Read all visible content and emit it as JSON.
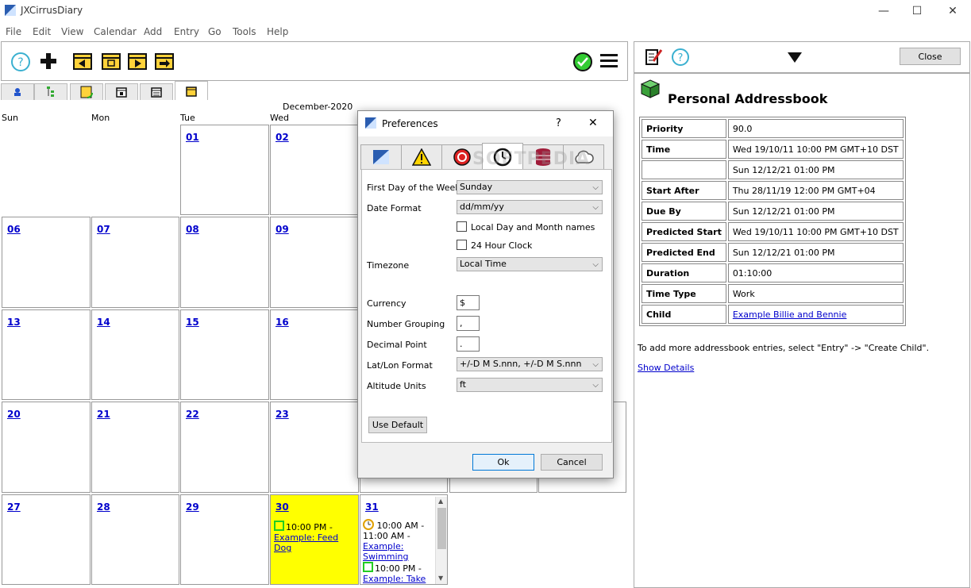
{
  "window": {
    "title": "JXCirrusDiary",
    "minimize": "—",
    "maximize": "☐",
    "close": "✕"
  },
  "menu": [
    "File",
    "Edit",
    "View",
    "Calendar",
    "Add",
    "Entry",
    "Go",
    "Tools",
    "Help"
  ],
  "calendar": {
    "month_title": "December-2020",
    "day_headers": [
      "Sun",
      "Mon",
      "Tue",
      "Wed"
    ],
    "weeks": [
      [
        "",
        "",
        "01",
        "02"
      ],
      [
        "06",
        "07",
        "08",
        "09"
      ],
      [
        "13",
        "14",
        "15",
        "16"
      ],
      [
        "20",
        "21",
        "22",
        "23"
      ],
      [
        "27",
        "28",
        "29",
        "30",
        "31"
      ]
    ],
    "events": {
      "d30": {
        "time": "10:00 PM -",
        "title": "Example: Feed Dog"
      },
      "d31a": {
        "time": "10:00 AM -",
        "time2": "11:00 AM -",
        "title1": "Example:",
        "title2": "Swimming"
      },
      "d31b": {
        "time": "10:00 PM -",
        "title": "Example: Take"
      }
    }
  },
  "right_panel": {
    "close_label": "Close",
    "title": "Personal Addressbook",
    "properties": [
      {
        "key": "Priority",
        "value": "90.0"
      },
      {
        "key": "Time",
        "value": "Wed 19/10/11 10:00 PM GMT+10 DST"
      },
      {
        "key": "",
        "value": "Sun 12/12/21 01:00 PM"
      },
      {
        "key": "Start After",
        "value": "Thu 28/11/19 12:00 PM GMT+04"
      },
      {
        "key": "Due By",
        "value": "Sun 12/12/21 01:00 PM"
      },
      {
        "key": "Predicted Start",
        "value": "Wed 19/10/11 10:00 PM GMT+10 DST"
      },
      {
        "key": "Predicted End",
        "value": "Sun 12/12/21 01:00 PM"
      },
      {
        "key": "Duration",
        "value": "01:10:00"
      },
      {
        "key": "Time Type",
        "value": "Work"
      },
      {
        "key": "Child",
        "value": "Example Billie and Bennie"
      }
    ],
    "hint": "To add more addressbook entries, select \"Entry\" -> \"Create Child\".",
    "show_details": "Show Details"
  },
  "dialog": {
    "title": "Preferences",
    "help": "?",
    "close": "✕",
    "fields": {
      "first_day_label": "First Day of the Week",
      "first_day_value": "Sunday",
      "date_format_label": "Date Format",
      "date_format_value": "dd/mm/yy",
      "local_names_label": "Local Day and Month names",
      "hour24_label": "24 Hour Clock",
      "timezone_label": "Timezone",
      "timezone_value": "Local Time",
      "currency_label": "Currency",
      "currency_value": "$",
      "grouping_label": "Number Grouping",
      "grouping_value": ",",
      "decimal_label": "Decimal Point",
      "decimal_value": ".",
      "latlon_label": "Lat/Lon Format",
      "latlon_value": "+/-D M S.nnn, +/-D M S.nnn",
      "altitude_label": "Altitude Units",
      "altitude_value": "ft"
    },
    "use_default": "Use Default",
    "ok": "Ok",
    "cancel": "Cancel"
  },
  "watermark": "SOFTPEDIA",
  "colors": {
    "today": "#ffff00",
    "link": "#0000cc",
    "ok_icon": "#22aa22"
  }
}
